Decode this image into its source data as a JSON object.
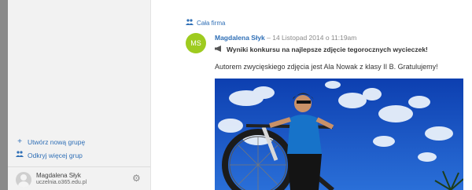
{
  "sidebar": {
    "create_group": {
      "icon": "plus-icon",
      "label": "Utwórz nową grupę"
    },
    "discover_groups": {
      "icon": "groups-icon",
      "label": "Odkryj więcej grup"
    },
    "user": {
      "name": "Magdalena Słyk",
      "email": "uczelnia.o365.edu.pl",
      "settings_icon": "gear-icon"
    }
  },
  "feed": {
    "group_link": {
      "icon": "groups-icon",
      "label": "Cała firma"
    },
    "post": {
      "avatar_initials": "MS",
      "avatar_color": "#9ecb1f",
      "author": "Magdalena Słyk",
      "separator": " – ",
      "date": "14 Listopad 2014 o 11:19am",
      "title_icon": "megaphone-icon",
      "title": "Wyniki konkursu na najlepsze zdjęcie tegorocznych wycieczek!",
      "body": "Autorem zwycięskiego zdjęcia jest Ala Nowak z klasy II B. Gratulujemy!",
      "image_icon": "cyclist-photo"
    }
  },
  "colors": {
    "link": "#2f6fb6",
    "sidebar_bg": "#f2f2f2",
    "avatar_green": "#9ecb1f"
  }
}
